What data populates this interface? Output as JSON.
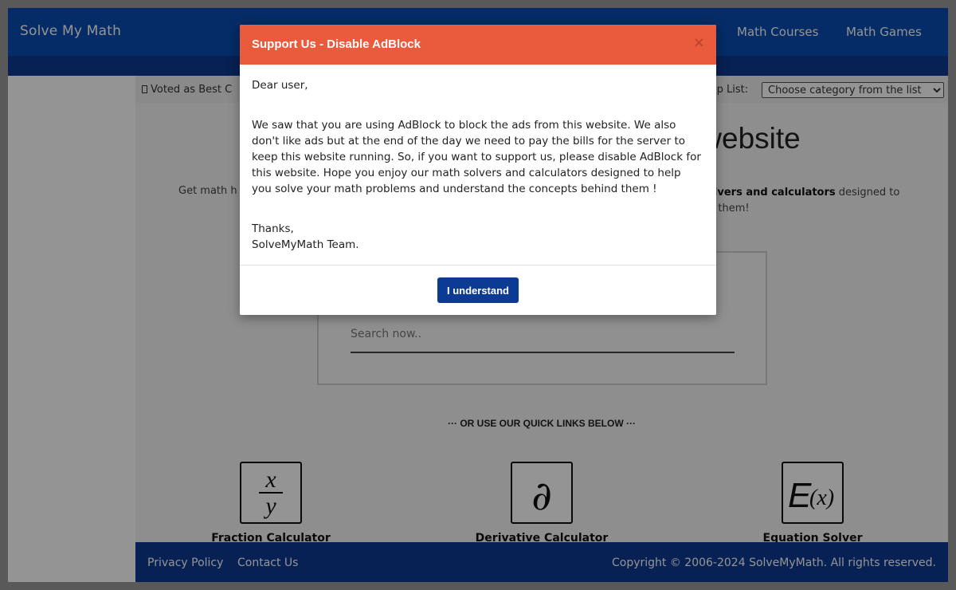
{
  "header": {
    "brand": "Solve My Math",
    "nav": {
      "courses": "Math Courses",
      "games": "Math Games"
    }
  },
  "topline": {
    "voted_text": "Voted as Best C",
    "help_label": "elp List:",
    "help_select_value": "Choose category from the list"
  },
  "hero": {
    "title": "website",
    "sub_left": "Get math h",
    "sub_right_bold": "olvers and calculators",
    "sub_right_tail": " designed to",
    "sub_right_line2": "d them!"
  },
  "search": {
    "placeholder": "Search now.."
  },
  "quick_links": {
    "label": "··· OR USE OUR QUICK LINKS BELOW ···",
    "items": [
      {
        "label": "Fraction Calculator",
        "icon": "fraction-icon"
      },
      {
        "label": "Derivative Calculator",
        "icon": "partial-derivative-icon"
      },
      {
        "label": "Equation Solver",
        "icon": "equation-icon"
      }
    ]
  },
  "footer": {
    "privacy": "Privacy Policy",
    "contact": "Contact Us",
    "copyright": "Copyright © 2006-2024 SolveMyMath. All rights reserved."
  },
  "modal": {
    "title": "Support Us - Disable AdBlock",
    "close": "×",
    "greeting": "Dear user,",
    "message": "We saw that you are using AdBlock to block the ads from this website. We also don't like ads but at the end of the day we need to pay the bills for the server to keep this website running. So, if you want to support us, please disable AdBlock for this website. Hope you enjoy our math solvers and calculators designed to help you solve your math problems and understand the concepts behind them !",
    "thanks": "Thanks,",
    "signature": "SolveMyMath Team.",
    "button": "I understand"
  },
  "colors": {
    "navbar": "#0a4cb0",
    "subbar": "#0d3a92",
    "modal_header": "#ea5a3d",
    "button": "#0d3a92"
  }
}
